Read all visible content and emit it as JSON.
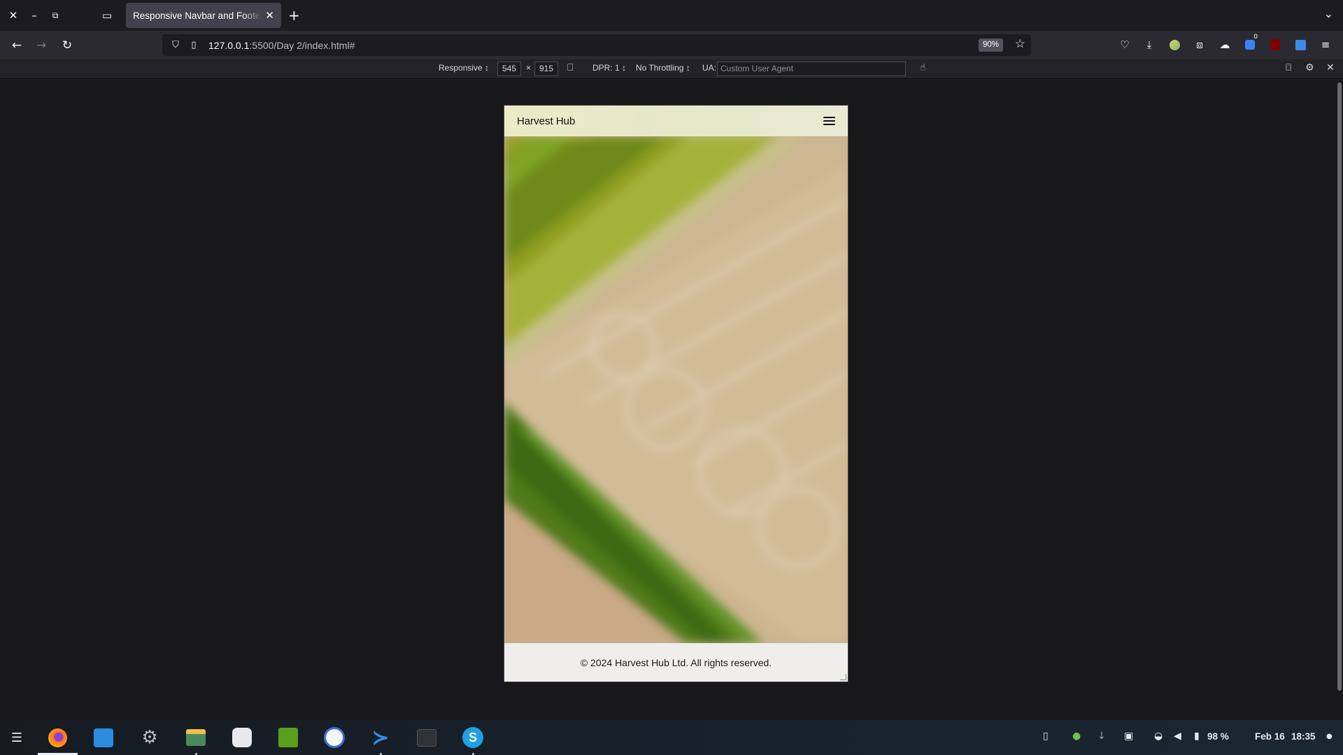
{
  "browser": {
    "tab_title": "Responsive Navbar and Footer",
    "url_host": "127.0.0.1",
    "url_rest": ":5500/Day 2/index.html#",
    "zoom": "90%",
    "extension_badge": "0"
  },
  "rdm": {
    "device": "Responsive ↕",
    "width": "545",
    "times": "×",
    "height": "915",
    "dpr": "DPR: 1 ↕",
    "throttling": "No Throttling ↕",
    "ua_label": "UA:",
    "ua_placeholder": "Custom User Agent"
  },
  "site": {
    "brand": "Harvest Hub",
    "footer_text": "© 2024 Harvest Hub Ltd. All rights reserved."
  },
  "taskbar": {
    "battery": "98 %",
    "date": "Feb 16",
    "time": "18:35"
  },
  "icons": {
    "close": "close-icon",
    "minimize": "minimize-icon",
    "restore": "restore-icon",
    "firefox_view": "firefox-view-icon",
    "new_tab": "plus-icon",
    "tab_list": "chevron-down-icon",
    "back": "back-arrow-icon",
    "forward": "forward-arrow-icon",
    "reload": "reload-icon",
    "shield": "shield-icon",
    "page": "page-icon",
    "bookmark": "star-icon",
    "hamburger": "hamburger-menu-icon"
  }
}
